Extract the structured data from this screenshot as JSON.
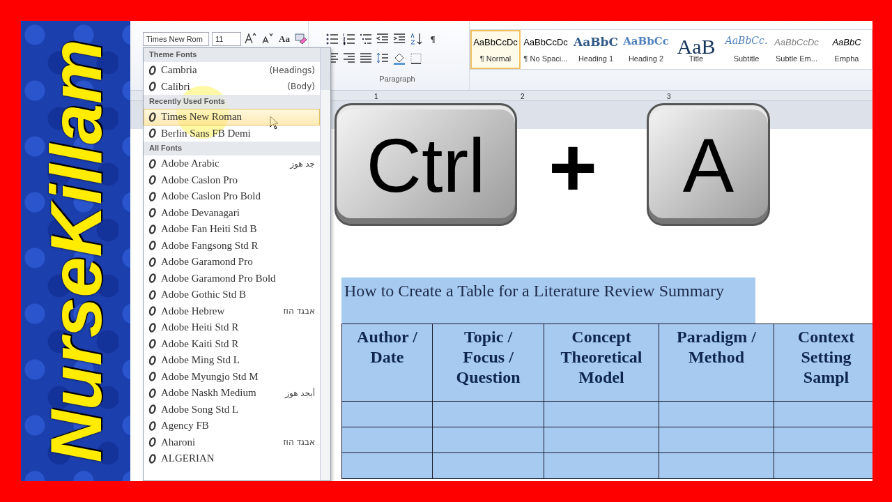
{
  "channel_banner": {
    "text": "NurseKillam"
  },
  "ribbon": {
    "font_name": "Times New Rom",
    "font_size": "11",
    "font_buttons": [
      {
        "kind": "icon"
      },
      {
        "kind": "icon"
      },
      {
        "kind": "text",
        "label": "Aa"
      },
      {
        "kind": "icon"
      }
    ],
    "paragraph_row1": [
      {
        "kind": "icon"
      },
      {
        "kind": "icon"
      },
      {
        "kind": "icon"
      },
      {
        "kind": "icon"
      },
      {
        "kind": "icon"
      },
      {
        "kind": "icon"
      },
      {
        "kind": "text",
        "label": "¶"
      }
    ],
    "paragraph_row2": [
      {
        "kind": "icon"
      },
      {
        "kind": "icon"
      },
      {
        "kind": "icon"
      },
      {
        "kind": "icon"
      },
      {
        "kind": "icon"
      },
      {
        "kind": "icon"
      }
    ],
    "paragraph_label": "Paragraph",
    "styles": [
      {
        "kind": "normal",
        "preview": "AaBbCcDc",
        "name": "¶ Normal",
        "selected": true
      },
      {
        "kind": "normal",
        "preview": "AaBbCcDc",
        "name": "¶ No Spaci...",
        "selected": false
      },
      {
        "kind": "heading1",
        "preview": "AaBbC",
        "name": "Heading 1",
        "selected": false
      },
      {
        "kind": "heading2",
        "preview": "AaBbCc",
        "name": "Heading 2",
        "selected": false
      },
      {
        "kind": "title",
        "preview": "AaB",
        "name": "Title",
        "selected": false
      },
      {
        "kind": "subtitle",
        "preview": "AaBbCc.",
        "name": "Subtitle",
        "selected": false
      },
      {
        "kind": "subtle",
        "preview": "AaBbCcDc",
        "name": "Subtle Em...",
        "selected": false
      },
      {
        "kind": "emphasis",
        "preview": "AaBbC",
        "name": "Empha",
        "selected": false
      }
    ]
  },
  "ruler": [
    "1",
    "2",
    "3"
  ],
  "font_dropdown": {
    "sections": [
      {
        "title": "Theme Fonts",
        "items": [
          {
            "name": "Cambria",
            "note": "(Headings)",
            "selected": false
          },
          {
            "name": "Calibri",
            "note": "(Body)",
            "selected": false
          }
        ]
      },
      {
        "title": "Recently Used Fonts",
        "items": [
          {
            "name": "Times New Roman",
            "selected": true
          },
          {
            "name": "Berlin Sans FB Demi",
            "selected": false
          }
        ]
      },
      {
        "title": "All Fonts",
        "items": [
          {
            "name": "Adobe Arabic",
            "note": "جد هوز",
            "selected": false
          },
          {
            "name": "Adobe Caslon Pro",
            "selected": false
          },
          {
            "name": "Adobe Caslon Pro Bold",
            "selected": false
          },
          {
            "name": "Adobe Devanagari",
            "selected": false
          },
          {
            "name": "Adobe Fan Heiti Std B",
            "selected": false
          },
          {
            "name": "Adobe Fangsong Std R",
            "selected": false
          },
          {
            "name": "Adobe Garamond Pro",
            "selected": false
          },
          {
            "name": "Adobe Garamond Pro Bold",
            "selected": false
          },
          {
            "name": "Adobe Gothic Std B",
            "selected": false
          },
          {
            "name": "Adobe Hebrew",
            "note": "אבגד הוז",
            "selected": false
          },
          {
            "name": "Adobe Heiti Std R",
            "selected": false
          },
          {
            "name": "Adobe Kaiti Std R",
            "selected": false
          },
          {
            "name": "Adobe Ming Std L",
            "selected": false
          },
          {
            "name": "Adobe Myungjo Std M",
            "selected": false
          },
          {
            "name": "Adobe Naskh Medium",
            "note": "أبجد هوز",
            "selected": false
          },
          {
            "name": "Adobe Song Std L",
            "selected": false
          },
          {
            "name": "Agency FB",
            "selected": false
          },
          {
            "name": "Aharoni",
            "note": "אבגד הוז",
            "selected": false
          },
          {
            "name": "ALGERIAN",
            "selected": false
          }
        ]
      }
    ]
  },
  "document": {
    "heading": "How to Create a Table for a Literature Review Summary",
    "table": {
      "columns": [
        "Author /\nDate",
        "Topic /\nFocus /\nQuestion",
        "Concept\nTheoretical\nModel",
        "Paradigm /\nMethod",
        "Context\nSetting\nSampl"
      ]
    }
  },
  "shortcut": {
    "keys": [
      "Ctrl",
      "A"
    ],
    "joiner": "+"
  }
}
